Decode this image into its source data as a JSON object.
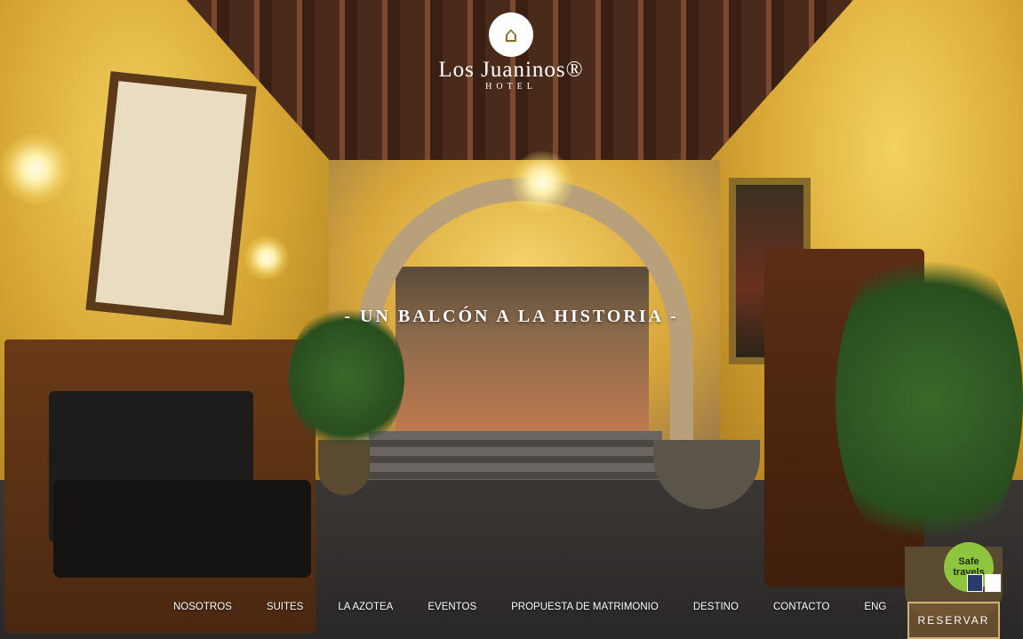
{
  "logo": {
    "emblem_icon": "building-crest-icon",
    "name": "Los Juaninos®",
    "subtitle": "HOTEL"
  },
  "hero": {
    "tagline": "- UN BALCÓN A LA HISTORIA -"
  },
  "nav": {
    "items": [
      {
        "label": "NOSOTROS"
      },
      {
        "label": "SUITES"
      },
      {
        "label": "LA AZOTEA"
      },
      {
        "label": "EVENTOS"
      },
      {
        "label": "PROPUESTA DE MATRIMONIO"
      },
      {
        "label": "DESTINO"
      },
      {
        "label": "CONTACTO"
      },
      {
        "label": "ENG"
      }
    ]
  },
  "reserve_button": {
    "label": "RESERVAR"
  },
  "safe_travels": {
    "line1": "Safe",
    "line2": "travels"
  },
  "colors": {
    "accent": "#cdb07a",
    "badge": "#8fc43f"
  }
}
